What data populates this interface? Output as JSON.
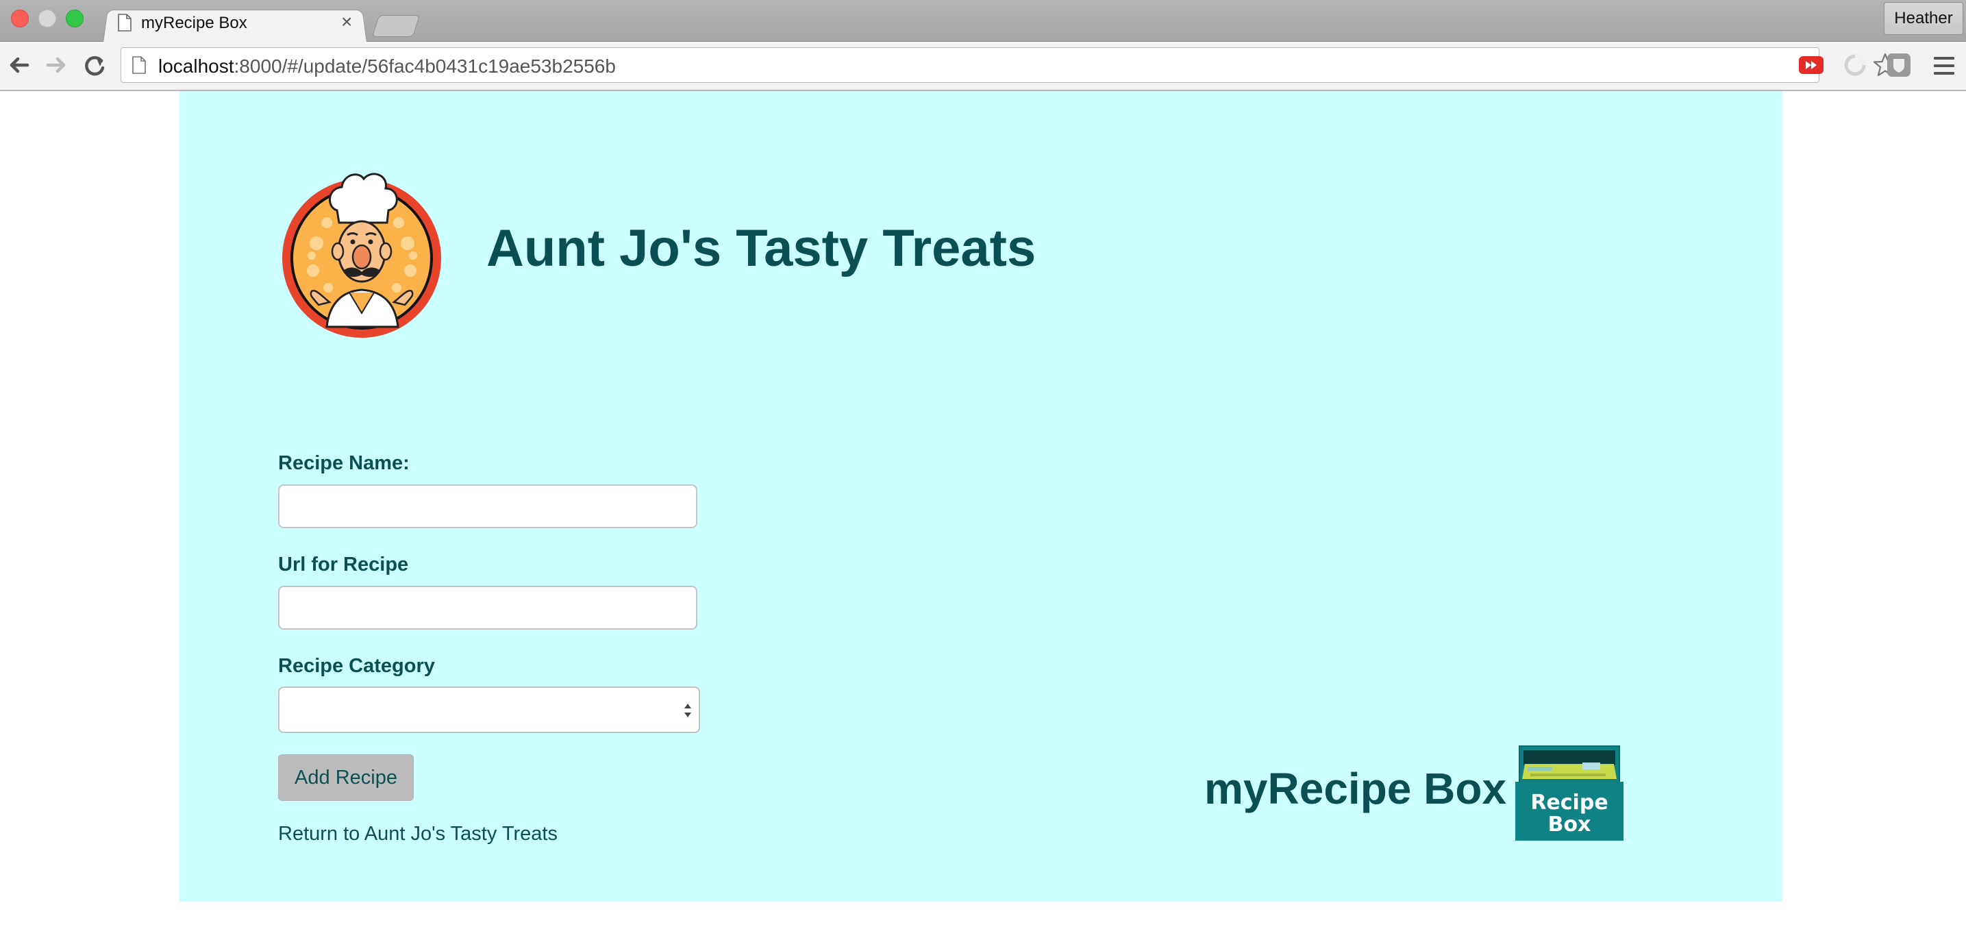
{
  "browser": {
    "tab_title": "myRecipe Box",
    "url_host": "localhost",
    "url_path": ":8000/#/update/56fac4b0431c19ae53b2556b",
    "profile_name": "Heather"
  },
  "header": {
    "title": "Aunt Jo's Tasty Treats",
    "logo_icon": "chef-icon"
  },
  "form": {
    "recipe_name_label": "Recipe Name:",
    "recipe_name_value": "",
    "url_label": "Url for Recipe",
    "url_value": "",
    "category_label": "Recipe Category",
    "category_value": "",
    "submit_label": "Add Recipe",
    "return_link": "Return to Aunt Jo's Tasty Treats"
  },
  "footer": {
    "brand": "myRecipe Box",
    "box_logo_text_line1": "Recipe",
    "box_logo_text_line2": "Box"
  },
  "colors": {
    "page_background": "#ccffff",
    "text_teal": "#0a5052",
    "button_gray": "#bcbcbc",
    "box_teal": "#0f8383"
  }
}
